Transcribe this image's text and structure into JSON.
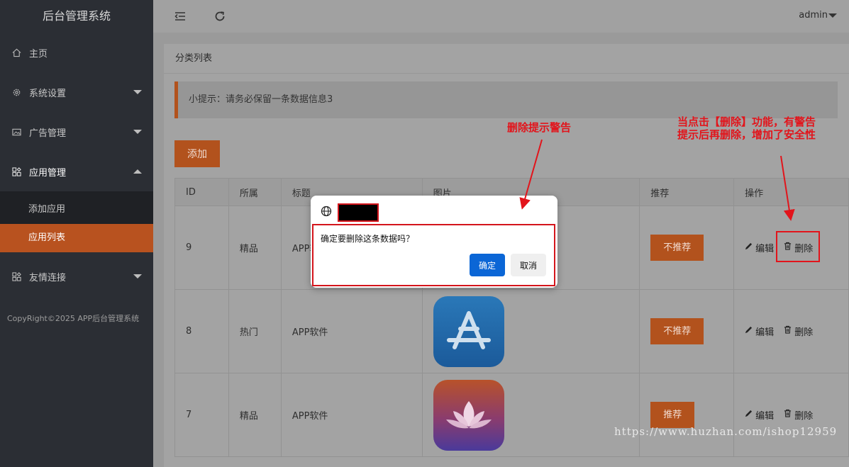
{
  "sidebar": {
    "brand": "后台管理系统",
    "items": [
      {
        "label": "主页"
      },
      {
        "label": "系统设置"
      },
      {
        "label": "广告管理"
      },
      {
        "label": "应用管理"
      },
      {
        "label": "友情连接"
      }
    ],
    "subitems": [
      {
        "label": "添加应用"
      },
      {
        "label": "应用列表"
      }
    ],
    "copyright": "CopyRight©2025 APP后台管理系统"
  },
  "topbar": {
    "user": "admin"
  },
  "card": {
    "title": "分类列表",
    "tip": "小提示：请务必保留一条数据信息3",
    "add_label": "添加"
  },
  "table": {
    "headers": [
      "ID",
      "所属",
      "标题",
      "图片",
      "推荐",
      "操作"
    ],
    "rows": [
      {
        "id": "9",
        "category": "精品",
        "title": "APP软件",
        "recommend": "不推荐",
        "edit": "编辑",
        "delete": "删除"
      },
      {
        "id": "8",
        "category": "热门",
        "title": "APP软件",
        "recommend": "不推荐",
        "edit": "编辑",
        "delete": "删除"
      },
      {
        "id": "7",
        "category": "精品",
        "title": "APP软件",
        "recommend": "推荐",
        "edit": "编辑",
        "delete": "删除"
      }
    ]
  },
  "dialog": {
    "message": "确定要删除这条数据吗？",
    "ok_label": "确定",
    "cancel_label": "取消"
  },
  "annotations": {
    "dialog_note": "删除提示警告",
    "delete_note_line1": "当点击【删除】功能，有警告",
    "delete_note_line2": "提示后再删除，增加了安全性"
  },
  "watermark": "https://www.huzhan.com/ishop12959",
  "colors": {
    "accent": "#b2521d",
    "sidebar": "#2b2e34",
    "annotation": "#e2141b",
    "primary": "#0b66d6"
  }
}
